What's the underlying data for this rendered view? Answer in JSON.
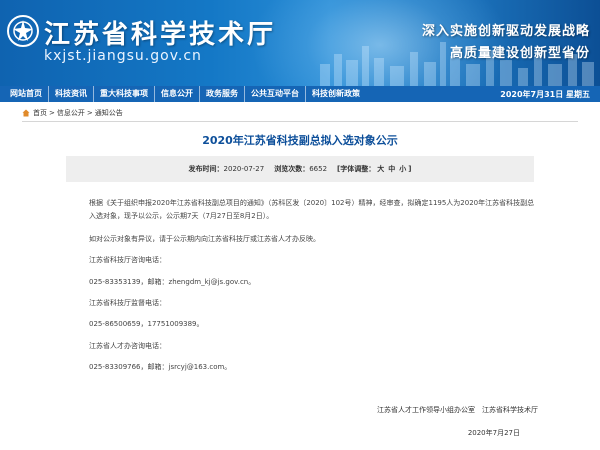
{
  "header": {
    "site_title": "江苏省科学技术厅",
    "site_url": "kxjst.jiangsu.gov.cn",
    "slogan_line1": "深入实施创新驱动发展战略",
    "slogan_line2": "高质量建设创新型省份"
  },
  "nav": {
    "items": [
      {
        "label": "网站首页"
      },
      {
        "label": "科技资讯"
      },
      {
        "label": "重大科技事项"
      },
      {
        "label": "信息公开"
      },
      {
        "label": "政务服务"
      },
      {
        "label": "公共互动平台"
      },
      {
        "label": "科技创新政策"
      }
    ],
    "date": "2020年7月31日 星期五"
  },
  "breadcrumb": {
    "items": [
      "首页",
      ">",
      "信息公开",
      ">",
      "通知公告"
    ]
  },
  "article": {
    "title": "2020年江苏省科技副总拟入选对象公示",
    "meta": {
      "publish_label": "发布时间：",
      "publish_date": "2020-07-27",
      "views_label": "浏览次数：",
      "views_count": "6652",
      "font_label": "[字体调整：",
      "font_large": "大",
      "font_medium": "中",
      "font_small": "小",
      "font_end": "]"
    },
    "paragraphs": [
      "根据《关于组织申报2020年江苏省科技副总项目的通知》（苏科区发〔2020〕102号）精神，经审查，拟确定1195人为2020年江苏省科技副总入选对象，现予以公示，公示期7天（7月27日至8月2日）。",
      "如对公示对象有异议，请于公示期内向江苏省科技厅或江苏省人才办反映。",
      "江苏省科技厅咨询电话：",
      "025-83353139，邮箱：zhengdm_kj@js.gov.cn。",
      "江苏省科技厅监督电话：",
      "025-86500659，17751009389。",
      "江苏省人才办咨询电话：",
      "025-83309766，邮箱：jsrcyj@163.com。"
    ],
    "signature": "江苏省人才工作领导小组办公室　江苏省科学技术厅",
    "date": "2020年7月27日"
  }
}
